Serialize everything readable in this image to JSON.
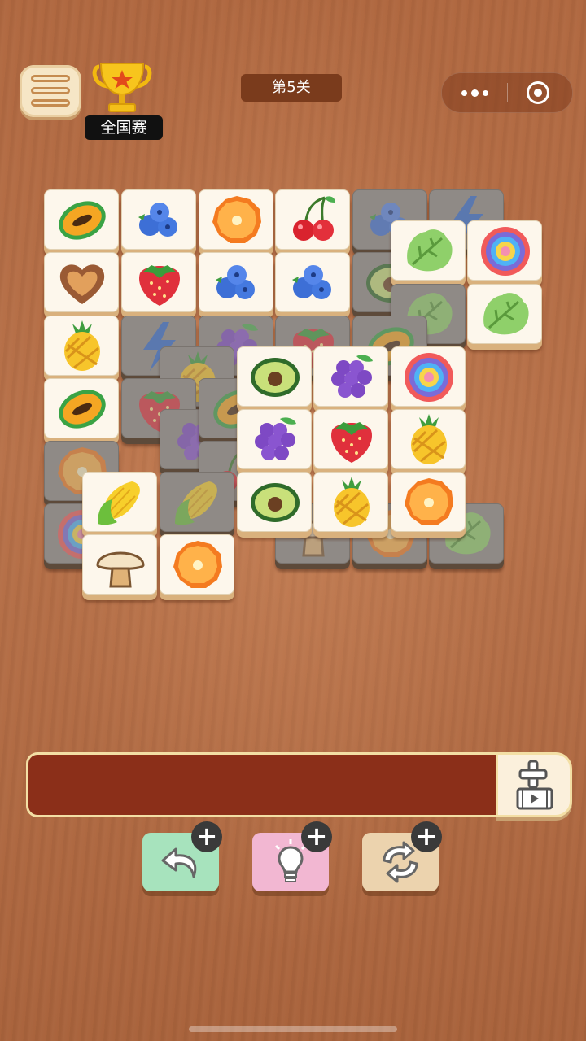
{
  "header": {
    "menu_icon": "list-menu-icon",
    "trophy_icon": "trophy-icon",
    "national_label": "全国赛",
    "level_label": "第5关",
    "capsule": {
      "more_icon": "more-dots-icon",
      "target_icon": "target-circle-icon"
    }
  },
  "board": {
    "tiles": [
      {
        "icon": "blueberry",
        "dim": true
      },
      {
        "icon": "blue-bolt",
        "dim": true
      },
      {
        "icon": "papaya",
        "dim": false
      },
      {
        "icon": "blueberry",
        "dim": false
      },
      {
        "icon": "orange",
        "dim": false
      },
      {
        "icon": "cherry",
        "dim": false
      },
      {
        "icon": "avocado",
        "dim": true
      },
      {
        "icon": "lettuce",
        "dim": false
      },
      {
        "icon": "lollipop",
        "dim": false
      },
      {
        "icon": "lettuce",
        "dim": true
      },
      {
        "icon": "lettuce",
        "dim": false
      },
      {
        "icon": "cookie-heart",
        "dim": false
      },
      {
        "icon": "strawberry",
        "dim": false
      },
      {
        "icon": "blueberry",
        "dim": false
      },
      {
        "icon": "blueberry",
        "dim": false
      },
      {
        "icon": "blue-bolt",
        "dim": true
      },
      {
        "icon": "grape",
        "dim": true
      },
      {
        "icon": "strawberry",
        "dim": true
      },
      {
        "icon": "papaya",
        "dim": true
      },
      {
        "icon": "pineapple",
        "dim": false
      },
      {
        "icon": "pineapple",
        "dim": true
      },
      {
        "icon": "papaya",
        "dim": false
      },
      {
        "icon": "strawberry",
        "dim": true
      },
      {
        "icon": "grape",
        "dim": true
      },
      {
        "icon": "papaya",
        "dim": true
      },
      {
        "icon": "orange",
        "dim": true
      },
      {
        "icon": "cherry",
        "dim": true
      },
      {
        "icon": "lollipop",
        "dim": true
      },
      {
        "icon": "corn",
        "dim": true
      },
      {
        "icon": "mushroom",
        "dim": true
      },
      {
        "icon": "orange",
        "dim": true
      },
      {
        "icon": "lettuce",
        "dim": true
      },
      {
        "icon": "avocado",
        "dim": false
      },
      {
        "icon": "grape",
        "dim": false
      },
      {
        "icon": "lollipop",
        "dim": false
      },
      {
        "icon": "grape",
        "dim": false
      },
      {
        "icon": "strawberry",
        "dim": false
      },
      {
        "icon": "pineapple",
        "dim": false
      },
      {
        "icon": "avocado",
        "dim": false
      },
      {
        "icon": "pineapple",
        "dim": false
      },
      {
        "icon": "orange",
        "dim": false
      },
      {
        "icon": "corn",
        "dim": false
      },
      {
        "icon": "mushroom",
        "dim": false
      },
      {
        "icon": "orange",
        "dim": false
      }
    ]
  },
  "tray": {
    "slots_filled": 0,
    "add_slot_icon": "plus-video-icon"
  },
  "tools": [
    {
      "name": "undo",
      "icon": "undo-arrow-icon",
      "color": "#a7e3bd",
      "badge": "+"
    },
    {
      "name": "hint",
      "icon": "lightbulb-icon",
      "color": "#f2b7d2",
      "badge": "+"
    },
    {
      "name": "shuffle",
      "icon": "shuffle-icon",
      "color": "#ecd3ae",
      "badge": "+"
    }
  ]
}
